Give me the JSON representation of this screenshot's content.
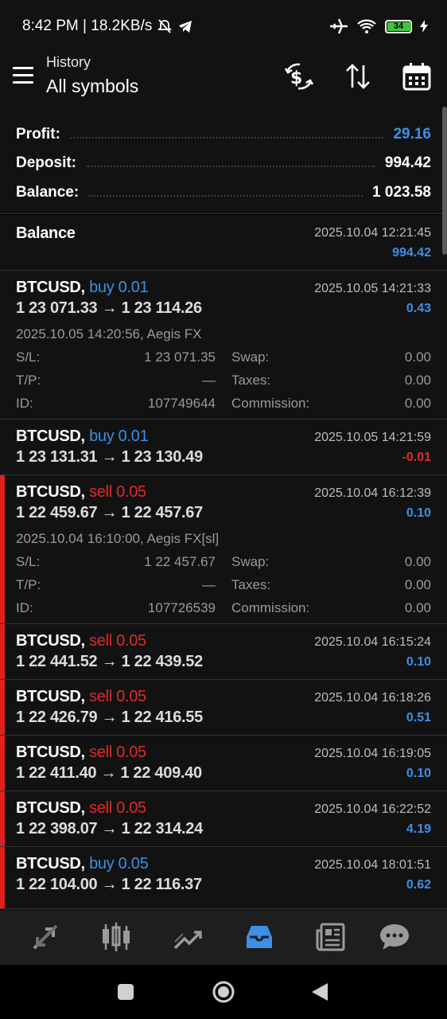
{
  "status_bar": {
    "time_speed": "8:42 PM | 18.2KB/s",
    "battery": "34"
  },
  "header": {
    "subtitle": "History",
    "title": "All symbols"
  },
  "summary": {
    "profit_label": "Profit:",
    "profit_value": "29.16",
    "deposit_label": "Deposit:",
    "deposit_value": "994.42",
    "balance_label": "Balance:",
    "balance_value": "1 023.58"
  },
  "deals": [
    {
      "symbol": "Balance",
      "dir": "",
      "prices": "",
      "time": "2025.10.04 12:21:45",
      "profit": "994.42"
    },
    {
      "symbol": "BTCUSD,",
      "dir": "buy 0.01",
      "prices": "1 23 071.33 → 1 23 114.26",
      "time": "2025.10.05 14:21:33",
      "profit": "0.43",
      "meta": "2025.10.05 14:20:56, Aegis FX",
      "sl_label": "S/L:",
      "sl": "1 23 071.35",
      "tp_label": "T/P:",
      "tp": "—",
      "id_label": "ID:",
      "id": "107749644",
      "swap_label": "Swap:",
      "swap": "0.00",
      "taxes_label": "Taxes:",
      "taxes": "0.00",
      "commission_label": "Commission:",
      "commission": "0.00"
    },
    {
      "symbol": "BTCUSD,",
      "dir": "buy 0.01",
      "prices": "1 23 131.31 → 1 23 130.49",
      "time": "2025.10.05 14:21:59",
      "profit": "-0.01"
    },
    {
      "symbol": "BTCUSD,",
      "dir": "sell 0.05",
      "prices": "1 22 459.67 → 1 22 457.67",
      "time": "2025.10.04 16:12:39",
      "profit": "0.10",
      "meta": "2025.10.04 16:10:00, Aegis FX[sl]",
      "sl_label": "S/L:",
      "sl": "1 22 457.67",
      "tp_label": "T/P:",
      "tp": "—",
      "id_label": "ID:",
      "id": "107726539",
      "swap_label": "Swap:",
      "swap": "0.00",
      "taxes_label": "Taxes:",
      "taxes": "0.00",
      "commission_label": "Commission:",
      "commission": "0.00"
    },
    {
      "symbol": "BTCUSD,",
      "dir": "sell 0.05",
      "prices": "1 22 441.52 → 1 22 439.52",
      "time": "2025.10.04 16:15:24",
      "profit": "0.10"
    },
    {
      "symbol": "BTCUSD,",
      "dir": "sell 0.05",
      "prices": "1 22 426.79 → 1 22 416.55",
      "time": "2025.10.04 16:18:26",
      "profit": "0.51"
    },
    {
      "symbol": "BTCUSD,",
      "dir": "sell 0.05",
      "prices": "1 22 411.40 → 1 22 409.40",
      "time": "2025.10.04 16:19:05",
      "profit": "0.10"
    },
    {
      "symbol": "BTCUSD,",
      "dir": "sell 0.05",
      "prices": "1 22 398.07 → 1 22 314.24",
      "time": "2025.10.04 16:22:52",
      "profit": "4.19"
    },
    {
      "symbol": "BTCUSD,",
      "dir": "buy 0.05",
      "prices": "1 22 104.00 → 1 22 116.37",
      "time": "2025.10.04 18:01:51",
      "profit": "0.62"
    }
  ],
  "bottom_nav": [
    "quotes-icon",
    "chart-icon",
    "trade-icon",
    "history-icon",
    "news-icon",
    "chat-icon"
  ],
  "colors": {
    "accent": "#3d8fe8",
    "sell": "#e02a2a",
    "bg": "#121212"
  }
}
